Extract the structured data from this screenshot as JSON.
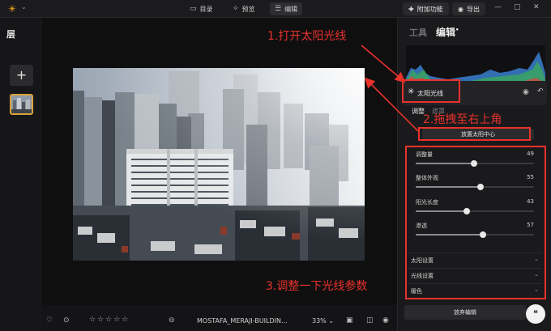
{
  "topbar": {
    "nav": [
      {
        "icon": "folder-icon",
        "label": "目录"
      },
      {
        "icon": "magic-wand-icon",
        "label": "预览"
      },
      {
        "icon": "sliders-icon",
        "label": "编辑"
      }
    ],
    "addons_label": "附加功能",
    "export_label": "导出"
  },
  "left": {
    "title": "层"
  },
  "bottom": {
    "filename": "MOSTAFA_MERAJI-BUILDIN...",
    "zoom": "33%"
  },
  "right": {
    "tab_tools": "工具",
    "tab_edit": "编辑",
    "tool_name": "太阳光线",
    "subtab_adjust": "调整",
    "subtab_mask": "遮罩",
    "place_center": "放置太阳中心",
    "sliders": [
      {
        "label": "调整量",
        "value": 49,
        "max": 100
      },
      {
        "label": "整体外观",
        "value": 55,
        "max": 100
      },
      {
        "label": "阳光长度",
        "value": 43,
        "max": 100
      },
      {
        "label": "渗透",
        "value": 57,
        "max": 100
      }
    ],
    "sections": [
      "太阳设置",
      "光线设置",
      "暖色"
    ],
    "discard": "放弃编辑"
  },
  "annotations": {
    "step1": "1.打开太阳光线",
    "step2": "2.拖拽至右上角",
    "step3": "3.调整一下光线参数"
  },
  "colors": {
    "accent": "#f0a020",
    "annotation": "#e8322c"
  }
}
